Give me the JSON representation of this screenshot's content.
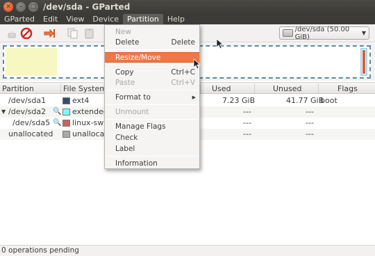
{
  "window": {
    "title": "/dev/sda - GParted"
  },
  "menubar": [
    "GParted",
    "Edit",
    "View",
    "Device",
    "Partition",
    "Help"
  ],
  "device_selector": {
    "label": "/dev/sda   (50.00 GiB)"
  },
  "table": {
    "headers": [
      "Partition",
      "File System",
      "Used",
      "Unused",
      "Flags"
    ],
    "rows": [
      {
        "partition": "/dev/sda1",
        "fs": "ext4",
        "fs_color": "#314e6c",
        "used": "7.23 GiB",
        "unused": "41.77 GiB",
        "flags": "boot"
      },
      {
        "partition": "/dev/sda2",
        "fs": "extended",
        "fs_color": "#7dfcfe",
        "used": "---",
        "unused": "---",
        "flags": ""
      },
      {
        "partition": "/dev/sda5",
        "fs": "linux-swap",
        "fs_color": "#c1665a",
        "used": "---",
        "unused": "---",
        "flags": ""
      },
      {
        "partition": "unallocated",
        "fs": "unallocated",
        "fs_color": "#a9a9a9",
        "used": "---",
        "unused": "---",
        "flags": ""
      }
    ]
  },
  "partition_menu": {
    "items": [
      {
        "label": "New",
        "accel": "",
        "disabled": true
      },
      {
        "label": "Delete",
        "accel": "Delete",
        "disabled": false
      },
      {
        "label": "Resize/Move",
        "accel": "",
        "disabled": false,
        "highlighted": true
      },
      {
        "label": "Copy",
        "accel": "Ctrl+C",
        "disabled": false
      },
      {
        "label": "Paste",
        "accel": "Ctrl+V",
        "disabled": true
      },
      {
        "label": "Format to",
        "accel": "",
        "disabled": false,
        "submenu": true
      },
      {
        "label": "Unmount",
        "accel": "",
        "disabled": true
      },
      {
        "label": "Manage Flags",
        "accel": "",
        "disabled": false
      },
      {
        "label": "Check",
        "accel": "",
        "disabled": false
      },
      {
        "label": "Label",
        "accel": "",
        "disabled": false
      },
      {
        "label": "Information",
        "accel": "",
        "disabled": false
      }
    ]
  },
  "status": {
    "text": "0 operations pending"
  },
  "colors": {
    "accent": "#f07746",
    "titlebar": "#3c3b37",
    "used_fill": "#f7f7c1"
  }
}
